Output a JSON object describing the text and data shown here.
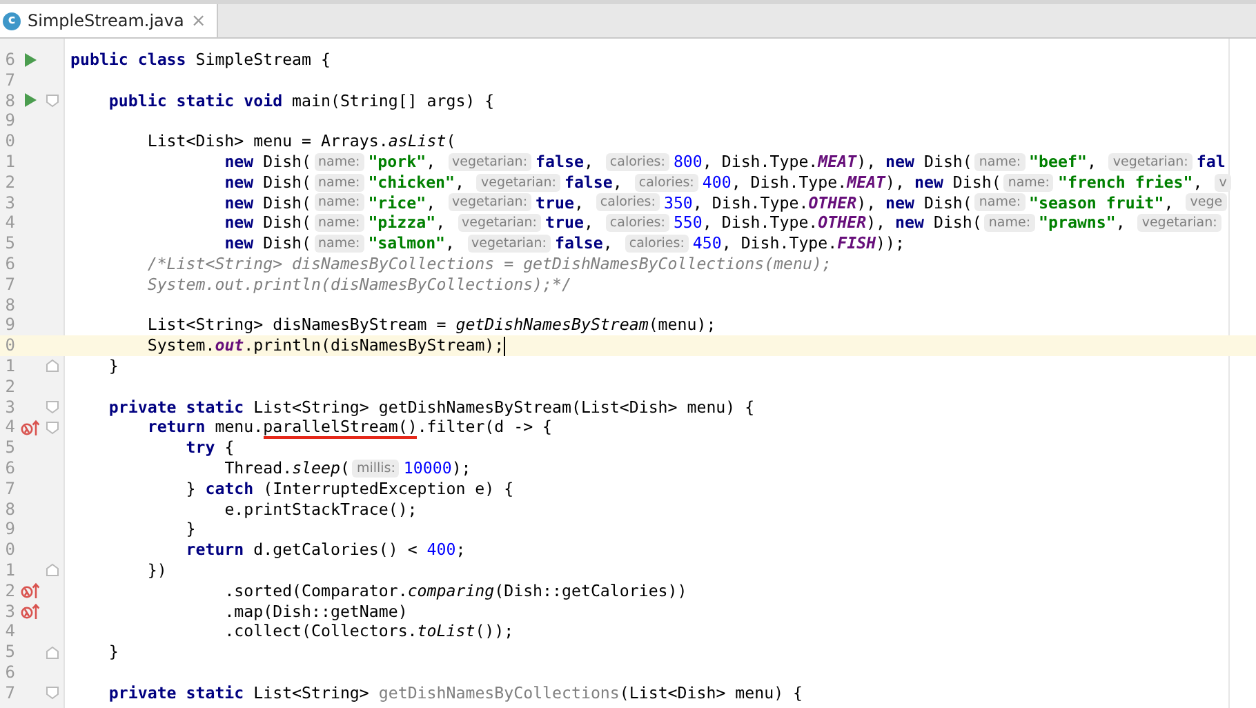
{
  "tab": {
    "icon_label": "c",
    "title": "SimpleStream.java",
    "close": "×",
    "selected": true
  },
  "lines": [
    {
      "number": "6",
      "current": false,
      "icons": [
        {
          "kind": "run"
        }
      ],
      "tokens": [
        {
          "kind": "keyword",
          "text": "public class"
        },
        {
          "kind": "plain",
          "text": " SimpleStream {"
        }
      ]
    },
    {
      "number": "7",
      "current": false
    },
    {
      "number": "8",
      "current": false,
      "icons": [
        {
          "kind": "run"
        },
        {
          "kind": "fold_start"
        }
      ],
      "tokens": [
        {
          "kind": "keyword",
          "text": "    public static void"
        },
        {
          "kind": "plain",
          "text": " main(String[] args) {"
        }
      ]
    },
    {
      "number": "9",
      "current": false
    },
    {
      "number": "0",
      "current": false,
      "tokens": [
        {
          "kind": "plain",
          "text": "        List<Dish> menu = Arrays."
        },
        {
          "kind": "static",
          "text": "asList"
        },
        {
          "kind": "plain",
          "text": "("
        }
      ]
    },
    {
      "number": "1",
      "current": false,
      "tokens": [
        {
          "kind": "keyword",
          "text": "                new"
        },
        {
          "kind": "plain",
          "text": " Dish("
        },
        {
          "kind": "hint",
          "text": "name:"
        },
        {
          "kind": "string",
          "text": "\"pork\""
        },
        {
          "kind": "plain",
          "text": ", "
        },
        {
          "kind": "hint",
          "text": "vegetarian:"
        },
        {
          "kind": "keyword",
          "text": "false"
        },
        {
          "kind": "plain",
          "text": ", "
        },
        {
          "kind": "hint",
          "text": "calories:"
        },
        {
          "kind": "number",
          "text": "800"
        },
        {
          "kind": "plain",
          "text": ", Dish.Type."
        },
        {
          "kind": "constant",
          "text": "MEAT"
        },
        {
          "kind": "plain",
          "text": "), "
        },
        {
          "kind": "keyword",
          "text": "new"
        },
        {
          "kind": "plain",
          "text": " Dish("
        },
        {
          "kind": "hint",
          "text": "name:"
        },
        {
          "kind": "string",
          "text": "\"beef\""
        },
        {
          "kind": "plain",
          "text": ", "
        },
        {
          "kind": "hint",
          "text": "vegetarian:"
        },
        {
          "kind": "keyword",
          "text": "fal"
        }
      ]
    },
    {
      "number": "2",
      "current": false,
      "tokens": [
        {
          "kind": "keyword",
          "text": "                new"
        },
        {
          "kind": "plain",
          "text": " Dish("
        },
        {
          "kind": "hint",
          "text": "name:"
        },
        {
          "kind": "string",
          "text": "\"chicken\""
        },
        {
          "kind": "plain",
          "text": ", "
        },
        {
          "kind": "hint",
          "text": "vegetarian:"
        },
        {
          "kind": "keyword",
          "text": "false"
        },
        {
          "kind": "plain",
          "text": ", "
        },
        {
          "kind": "hint",
          "text": "calories:"
        },
        {
          "kind": "number",
          "text": "400"
        },
        {
          "kind": "plain",
          "text": ", Dish.Type."
        },
        {
          "kind": "constant",
          "text": "MEAT"
        },
        {
          "kind": "plain",
          "text": "), "
        },
        {
          "kind": "keyword",
          "text": "new"
        },
        {
          "kind": "plain",
          "text": " Dish("
        },
        {
          "kind": "hint",
          "text": "name:"
        },
        {
          "kind": "string",
          "text": "\"french fries\""
        },
        {
          "kind": "plain",
          "text": ", "
        },
        {
          "kind": "hint",
          "text": "v"
        }
      ]
    },
    {
      "number": "3",
      "current": false,
      "tokens": [
        {
          "kind": "keyword",
          "text": "                new"
        },
        {
          "kind": "plain",
          "text": " Dish("
        },
        {
          "kind": "hint",
          "text": "name:"
        },
        {
          "kind": "string",
          "text": "\"rice\""
        },
        {
          "kind": "plain",
          "text": ", "
        },
        {
          "kind": "hint",
          "text": "vegetarian:"
        },
        {
          "kind": "keyword",
          "text": "true"
        },
        {
          "kind": "plain",
          "text": ", "
        },
        {
          "kind": "hint",
          "text": "calories:"
        },
        {
          "kind": "number",
          "text": "350"
        },
        {
          "kind": "plain",
          "text": ", Dish.Type."
        },
        {
          "kind": "constant",
          "text": "OTHER"
        },
        {
          "kind": "plain",
          "text": "), "
        },
        {
          "kind": "keyword",
          "text": "new"
        },
        {
          "kind": "plain",
          "text": " Dish("
        },
        {
          "kind": "hint",
          "text": "name:"
        },
        {
          "kind": "string",
          "text": "\"season fruit\""
        },
        {
          "kind": "plain",
          "text": ", "
        },
        {
          "kind": "hint",
          "text": "vege"
        }
      ]
    },
    {
      "number": "4",
      "current": false,
      "tokens": [
        {
          "kind": "keyword",
          "text": "                new"
        },
        {
          "kind": "plain",
          "text": " Dish("
        },
        {
          "kind": "hint",
          "text": "name:"
        },
        {
          "kind": "string",
          "text": "\"pizza\""
        },
        {
          "kind": "plain",
          "text": ", "
        },
        {
          "kind": "hint",
          "text": "vegetarian:"
        },
        {
          "kind": "keyword",
          "text": "true"
        },
        {
          "kind": "plain",
          "text": ", "
        },
        {
          "kind": "hint",
          "text": "calories:"
        },
        {
          "kind": "number",
          "text": "550"
        },
        {
          "kind": "plain",
          "text": ", Dish.Type."
        },
        {
          "kind": "constant",
          "text": "OTHER"
        },
        {
          "kind": "plain",
          "text": "), "
        },
        {
          "kind": "keyword",
          "text": "new"
        },
        {
          "kind": "plain",
          "text": " Dish("
        },
        {
          "kind": "hint",
          "text": "name:"
        },
        {
          "kind": "string",
          "text": "\"prawns\""
        },
        {
          "kind": "plain",
          "text": ", "
        },
        {
          "kind": "hint",
          "text": "vegetarian:"
        }
      ]
    },
    {
      "number": "5",
      "current": false,
      "tokens": [
        {
          "kind": "keyword",
          "text": "                new"
        },
        {
          "kind": "plain",
          "text": " Dish("
        },
        {
          "kind": "hint",
          "text": "name:"
        },
        {
          "kind": "string",
          "text": "\"salmon\""
        },
        {
          "kind": "plain",
          "text": ", "
        },
        {
          "kind": "hint",
          "text": "vegetarian:"
        },
        {
          "kind": "keyword",
          "text": "false"
        },
        {
          "kind": "plain",
          "text": ", "
        },
        {
          "kind": "hint",
          "text": "calories:"
        },
        {
          "kind": "number",
          "text": "450"
        },
        {
          "kind": "plain",
          "text": ", Dish.Type."
        },
        {
          "kind": "constant",
          "text": "FISH"
        },
        {
          "kind": "plain",
          "text": "));"
        }
      ]
    },
    {
      "number": "6",
      "current": false,
      "tokens": [
        {
          "kind": "comment",
          "text": "        /*List<String> disNamesByCollections = getDishNamesByCollections(menu);"
        }
      ]
    },
    {
      "number": "7",
      "current": false,
      "tokens": [
        {
          "kind": "comment",
          "text": "        System.out.println(disNamesByCollections);*/"
        }
      ]
    },
    {
      "number": "8",
      "current": false
    },
    {
      "number": "9",
      "current": false,
      "tokens": [
        {
          "kind": "plain",
          "text": "        List<String> disNamesByStream = "
        },
        {
          "kind": "static",
          "text": "getDishNamesByStream"
        },
        {
          "kind": "plain",
          "text": "(menu);"
        }
      ]
    },
    {
      "number": "0",
      "current": true,
      "tokens": [
        {
          "kind": "plain",
          "text": "        System."
        },
        {
          "kind": "field",
          "text": "out"
        },
        {
          "kind": "plain",
          "text": ".println(disNamesByStream);"
        }
      ]
    },
    {
      "number": "1",
      "current": false,
      "icons": [
        {
          "kind": "fold_end"
        }
      ],
      "tokens": [
        {
          "kind": "plain",
          "text": "    }"
        }
      ]
    },
    {
      "number": "2",
      "current": false
    },
    {
      "number": "3",
      "current": false,
      "icons": [
        {
          "kind": "fold_start"
        }
      ],
      "tokens": [
        {
          "kind": "keyword",
          "text": "    private static"
        },
        {
          "kind": "plain",
          "text": " List<String> getDishNamesByStream(List<Dish> menu) {"
        }
      ]
    },
    {
      "number": "4",
      "current": false,
      "icons": [
        {
          "kind": "override"
        },
        {
          "kind": "fold_start"
        }
      ],
      "tokens": [
        {
          "kind": "keyword",
          "text": "        return"
        },
        {
          "kind": "plain",
          "text": " menu."
        },
        {
          "kind": "underlined",
          "text": "parallelStream()"
        },
        {
          "kind": "plain",
          "text": ".filter(d -> {"
        }
      ]
    },
    {
      "number": "5",
      "current": false,
      "tokens": [
        {
          "kind": "keyword",
          "text": "            try"
        },
        {
          "kind": "plain",
          "text": " {"
        }
      ]
    },
    {
      "number": "6",
      "current": false,
      "tokens": [
        {
          "kind": "plain",
          "text": "                Thread."
        },
        {
          "kind": "static",
          "text": "sleep"
        },
        {
          "kind": "plain",
          "text": "("
        },
        {
          "kind": "hint",
          "text": "millis:"
        },
        {
          "kind": "number",
          "text": "10000"
        },
        {
          "kind": "plain",
          "text": ");"
        }
      ]
    },
    {
      "number": "7",
      "current": false,
      "tokens": [
        {
          "kind": "plain",
          "text": "            } "
        },
        {
          "kind": "keyword",
          "text": "catch"
        },
        {
          "kind": "plain",
          "text": " (InterruptedException e) {"
        }
      ]
    },
    {
      "number": "8",
      "current": false,
      "tokens": [
        {
          "kind": "plain",
          "text": "                e.printStackTrace();"
        }
      ]
    },
    {
      "number": "9",
      "current": false,
      "tokens": [
        {
          "kind": "plain",
          "text": "            }"
        }
      ]
    },
    {
      "number": "0",
      "current": false,
      "tokens": [
        {
          "kind": "keyword",
          "text": "            return"
        },
        {
          "kind": "plain",
          "text": " d.getCalories() < "
        },
        {
          "kind": "number",
          "text": "400"
        },
        {
          "kind": "plain",
          "text": ";"
        }
      ]
    },
    {
      "number": "1",
      "current": false,
      "icons": [
        {
          "kind": "fold_end"
        }
      ],
      "tokens": [
        {
          "kind": "plain",
          "text": "        })"
        }
      ]
    },
    {
      "number": "2",
      "current": false,
      "icons": [
        {
          "kind": "override"
        }
      ],
      "tokens": [
        {
          "kind": "plain",
          "text": "                .sorted(Comparator."
        },
        {
          "kind": "static",
          "text": "comparing"
        },
        {
          "kind": "plain",
          "text": "(Dish::getCalories))"
        }
      ]
    },
    {
      "number": "3",
      "current": false,
      "icons": [
        {
          "kind": "override"
        }
      ],
      "tokens": [
        {
          "kind": "plain",
          "text": "                .map(Dish::getName)"
        }
      ]
    },
    {
      "number": "4",
      "current": false,
      "tokens": [
        {
          "kind": "plain",
          "text": "                .collect(Collectors."
        },
        {
          "kind": "static",
          "text": "toList"
        },
        {
          "kind": "plain",
          "text": "());"
        }
      ]
    },
    {
      "number": "5",
      "current": false,
      "icons": [
        {
          "kind": "fold_end"
        }
      ],
      "tokens": [
        {
          "kind": "plain",
          "text": "    }"
        }
      ]
    },
    {
      "number": "6",
      "current": false
    },
    {
      "number": "7",
      "current": false,
      "icons": [
        {
          "kind": "fold_start"
        }
      ],
      "tokens": [
        {
          "kind": "keyword",
          "text": "    private static"
        },
        {
          "kind": "plain",
          "text": " List<String> "
        },
        {
          "kind": "unused",
          "text": "getDishNamesByCollections"
        },
        {
          "kind": "plain",
          "text": "(List<Dish> menu) {"
        }
      ]
    }
  ]
}
